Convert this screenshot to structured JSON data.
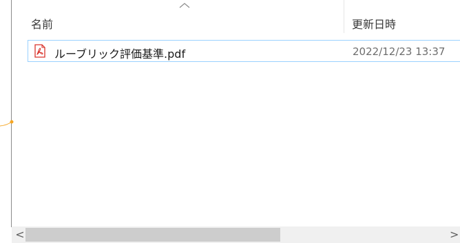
{
  "header": {
    "name_label": "名前",
    "date_label": "更新日時"
  },
  "files": [
    {
      "name": "ルーブリック評価基準.pdf",
      "modified": "2022/12/23 13:37",
      "icon": "pdf-icon"
    }
  ],
  "colors": {
    "selection_border": "#99d1ff",
    "pdf_red": "#d9332b",
    "connector_orange": "#f5a623"
  },
  "scrollbar": {
    "left_arrow": "<",
    "right_arrow": ">"
  }
}
